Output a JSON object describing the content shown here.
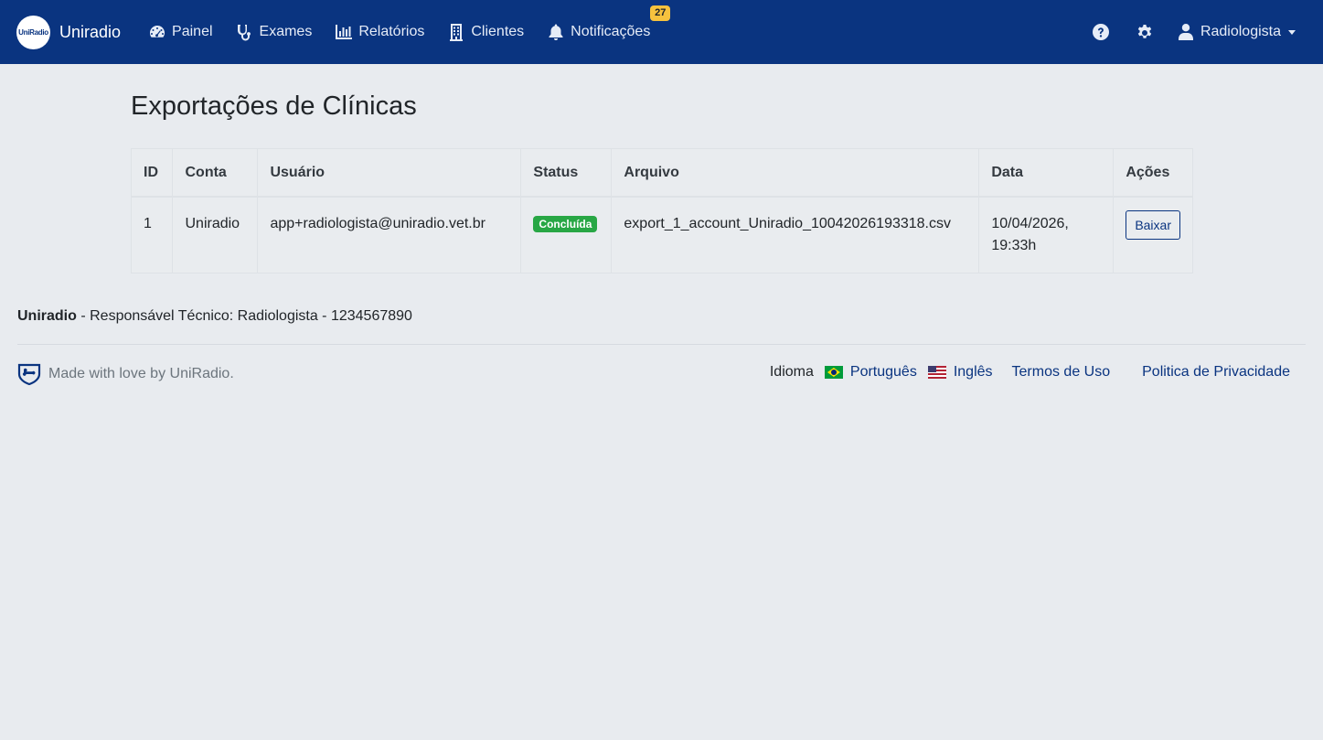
{
  "nav": {
    "brand_logo_text": "UniRadio",
    "brand_name": "Uniradio",
    "items": [
      {
        "label": "Painel",
        "icon": "dashboard-icon"
      },
      {
        "label": "Exames",
        "icon": "stethoscope-icon"
      },
      {
        "label": "Relatórios",
        "icon": "bar-chart-icon"
      },
      {
        "label": "Clientes",
        "icon": "building-icon"
      },
      {
        "label": "Notificações",
        "icon": "bell-icon"
      }
    ],
    "notifications_count": "27",
    "user_label": "Radiologista"
  },
  "page": {
    "title": "Exportações de Clínicas"
  },
  "table": {
    "headers": [
      "ID",
      "Conta",
      "Usuário",
      "Status",
      "Arquivo",
      "Data",
      "Ações"
    ],
    "rows": [
      {
        "id": "1",
        "conta": "Uniradio",
        "usuario": "app+radiologista@uniradio.vet.br",
        "status": "Concluída",
        "arquivo": "export_1_account_Uniradio_10042026193318.csv",
        "data": "10/04/2026, 19:33h",
        "action_label": "Baixar"
      }
    ]
  },
  "footer": {
    "company": "Uniradio",
    "responsible": " - Responsável Técnico: Radiologista - 1234567890",
    "made_with": "Made with love by UniRadio.",
    "language_label": "Idioma",
    "lang_pt": "Português",
    "lang_en": "Inglês",
    "terms": "Termos de Uso",
    "privacy": "Politica de Privacidade"
  },
  "colors": {
    "navbar": "#0a3480",
    "badge": "#f6c23e",
    "status_success": "#28a745",
    "link": "#0a3480"
  }
}
